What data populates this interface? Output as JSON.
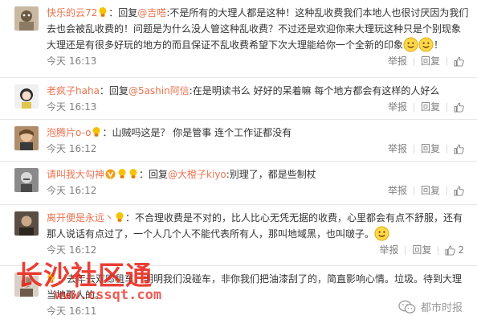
{
  "comments": [
    {
      "username": "快乐的云72",
      "reply_prefix": "：回复",
      "mention": "@吉嗒",
      "text_1": ":不是所有的大理人都是这种！这种乱收费我们本地人也很讨厌因为我们去也会被乱收费的！问题是为什么没人管这种乱收费？不过还是欢迎你来大理玩这种只是个别现象大理还是有很多好玩的地方的而且保证不乱收费希望下次大理能给你一个全新的印象",
      "text_2": "！",
      "time": "今天 16:13",
      "actions": {
        "report": "举报",
        "reply": "回复"
      }
    },
    {
      "username": "老疯子haha",
      "reply_prefix": "：回复",
      "mention": "@5ashin阿信",
      "text_1": ":在是明读书么 好好的呆着嘛 每个地方都会有这样的人好么",
      "time": "今天 16:13",
      "actions": {
        "report": "举报",
        "reply": "回复"
      }
    },
    {
      "username": "泡腾片o-o",
      "text_1": "：山贼吗这是？ 你是管事 连个工作证都没有",
      "time": "今天 16:12",
      "actions": {
        "report": "举报",
        "reply": "回复"
      }
    },
    {
      "username": "请叫我大勾神",
      "reply_prefix": "：回复",
      "mention": "@大橙子kiyo",
      "text_1": ":别理了，都是些制杖",
      "time": "今天 16:12",
      "actions": {
        "report": "举报",
        "reply": "回复"
      }
    },
    {
      "username": "离开便是永远丶",
      "text_1": "：不合理收费是不对的，比人比心无凭无据的收费，心里都会有点不舒服，还有那人说话有点过了，一个人几个人不能代表所有人，那叫地域黑，也叫啵子。",
      "time": "今天 16:12",
      "actions": {
        "report": "举报",
        "reply": "回复",
        "likes": "2"
      }
    },
    {
      "username": "长沙社区通",
      "text_1": "：去年去双廊租车，明明我们没碰车，非你我们把油漆刮了的，简直影响心情。垃圾。待到大理当地那人的。",
      "time": "今天 16:11",
      "actions": {}
    }
  ],
  "watermark": {
    "red_title": "长沙社区通",
    "red_url": "www.cssqt.com",
    "wechat_label": "都市时报"
  },
  "colors": {
    "username": "#eb7350",
    "text": "#333333",
    "meta": "#808080",
    "divider": "#e6e6e6",
    "watermark_red": "#e8261b"
  },
  "icons": [
    "avatar",
    "lightbulb-badge",
    "verified-v-badge",
    "smile-emoji",
    "thumb-up-icon",
    "wechat-icon"
  ]
}
